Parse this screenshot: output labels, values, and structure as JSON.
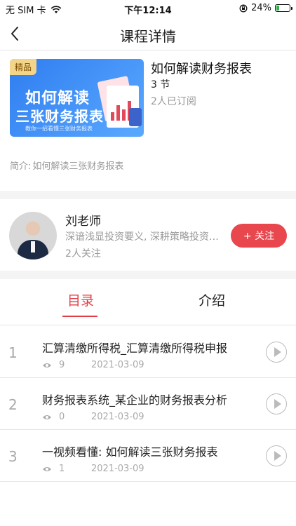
{
  "status_bar": {
    "carrier": "无 SIM 卡",
    "time": "下午12:14",
    "battery": "24%",
    "battery_level": 0.24
  },
  "nav": {
    "title": "课程详情"
  },
  "course": {
    "badge": "精品",
    "cover_line1": "如何解读",
    "cover_line2": "三张财务报表",
    "cover_sub": "教你一招看懂三张财务报表",
    "title": "如何解读财务报表",
    "lessons": "3 节",
    "subscribers": "2人已订阅",
    "intro_label": "简介:",
    "intro_text": "如何解读三张财务报表"
  },
  "teacher": {
    "name": "刘老师",
    "description": "深谙浅显投资要义, 深耕策略投资与价值投资",
    "followers": "2人关注",
    "follow_label": "+ 关注"
  },
  "tabs": {
    "catalog": "目录",
    "intro": "介绍"
  },
  "lessons": [
    {
      "index": "1",
      "title": "汇算清缴所得税_汇算清缴所得税申报",
      "views": "9",
      "date": "2021-03-09"
    },
    {
      "index": "2",
      "title": "财务报表系统_某企业的财务报表分析",
      "views": "0",
      "date": "2021-03-09"
    },
    {
      "index": "3",
      "title": "一视频看懂: 如何解读三张财务报表",
      "views": "1",
      "date": "2021-03-09"
    }
  ],
  "icons": {
    "back": "chevron-left-icon",
    "wifi": "wifi-icon",
    "lock": "rotation-lock-icon",
    "eye": "eye-icon",
    "play": "play-icon"
  },
  "colors": {
    "accent": "#e33d45",
    "follow_button": "#e8474e"
  }
}
